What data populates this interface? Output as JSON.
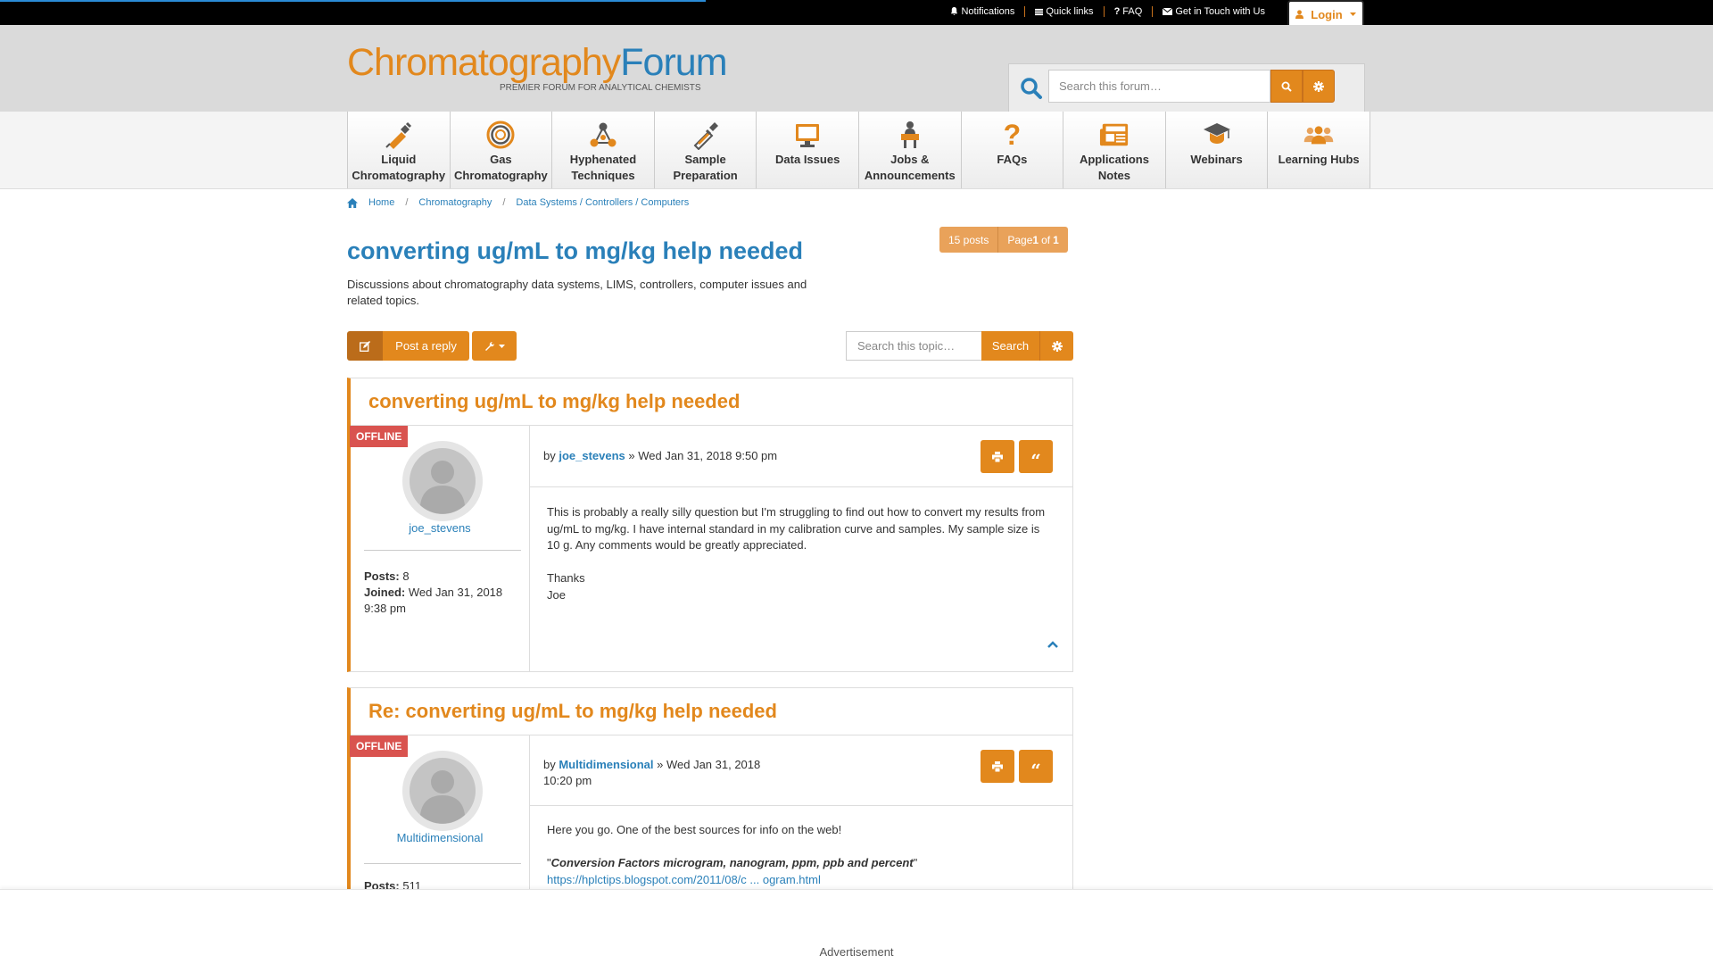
{
  "topbar": {
    "links": [
      {
        "label": "Notifications",
        "icon": "bell-icon"
      },
      {
        "label": "Quick links",
        "icon": "bars-icon"
      },
      {
        "label": "FAQ",
        "icon": "question-icon"
      },
      {
        "label": "Get in Touch with Us",
        "icon": "envelope-icon"
      }
    ],
    "login_label": "Login"
  },
  "header": {
    "logo_part1": "Chromatography",
    "logo_part2": "Forum",
    "tagline": "PREMIER FORUM FOR ANALYTICAL CHEMISTS",
    "search_placeholder": "Search this forum…"
  },
  "nav": {
    "items": [
      {
        "label": "Liquid Chromatography",
        "icon": "syringe-icon"
      },
      {
        "label": "Gas Chromatography",
        "icon": "gc-column-icon"
      },
      {
        "label": "Hyphenated Techniques",
        "icon": "molecule-icon"
      },
      {
        "label": "Sample Preparation",
        "icon": "pipette-icon"
      },
      {
        "label": "Data Issues",
        "icon": "monitor-icon"
      },
      {
        "label": "Jobs & Announcements",
        "icon": "job-icon"
      },
      {
        "label": "FAQs",
        "icon": "question-mark-icon"
      },
      {
        "label": "Applications Notes",
        "icon": "news-icon"
      },
      {
        "label": "Webinars",
        "icon": "graduation-cap-icon"
      },
      {
        "label": "Learning Hubs",
        "icon": "people-icon"
      }
    ]
  },
  "breadcrumb": {
    "items": [
      "Home",
      "Chromatography",
      "Data Systems / Controllers / Computers"
    ]
  },
  "pagination": {
    "posts": "15 posts",
    "page_prefix": "Page ",
    "page_current": "1",
    "page_of": " of ",
    "page_total": "1"
  },
  "topic": {
    "title": "converting ug/mL to mg/kg help needed",
    "description": "Discussions about chromatography data systems, LIMS, controllers, computer issues and related topics."
  },
  "actions": {
    "post_reply": "Post a reply",
    "search_placeholder": "Search this topic…",
    "search_label": "Search"
  },
  "posts": [
    {
      "title": "converting ug/mL to mg/kg help needed",
      "status": "OFFLINE",
      "author": "joe_stevens",
      "by": "by ",
      "date": " » Wed Jan 31, 2018 9:50 pm",
      "posts_label": "Posts:",
      "posts_count": " 8",
      "joined_label": "Joined:",
      "joined_date": " Wed Jan 31, 2018 9:38 pm",
      "body": [
        "This is probably a really silly question but I'm struggling to find out how to convert my results from ug/mL to mg/kg. I have internal standard in my calibration curve and samples. My sample size is 10 g. Any comments would be greatly appreciated.",
        "Thanks",
        "Joe"
      ]
    },
    {
      "title": "Re: converting ug/mL to mg/kg help needed",
      "status": "OFFLINE",
      "author": "Multidimensional",
      "by": "by ",
      "date_line1": " » Wed Jan 31, 2018",
      "date_line2": "10:20 pm",
      "posts_label": "Posts:",
      "posts_count": " 511",
      "body_intro": "Here you go. One of the best sources for info on the web!",
      "quote_open": "\"",
      "quote_text": "Conversion Factors microgram, nanogram, ppm, ppb and percent",
      "quote_close": "\"",
      "link": "https://hplctips.blogspot.com/2011/08/c ... ogram.html"
    }
  ],
  "ad": {
    "label": "Advertisement"
  },
  "colors": {
    "accent": "#e2881d",
    "link": "#2a80b9",
    "offline": "#d9534f",
    "topbar": "#000000"
  }
}
